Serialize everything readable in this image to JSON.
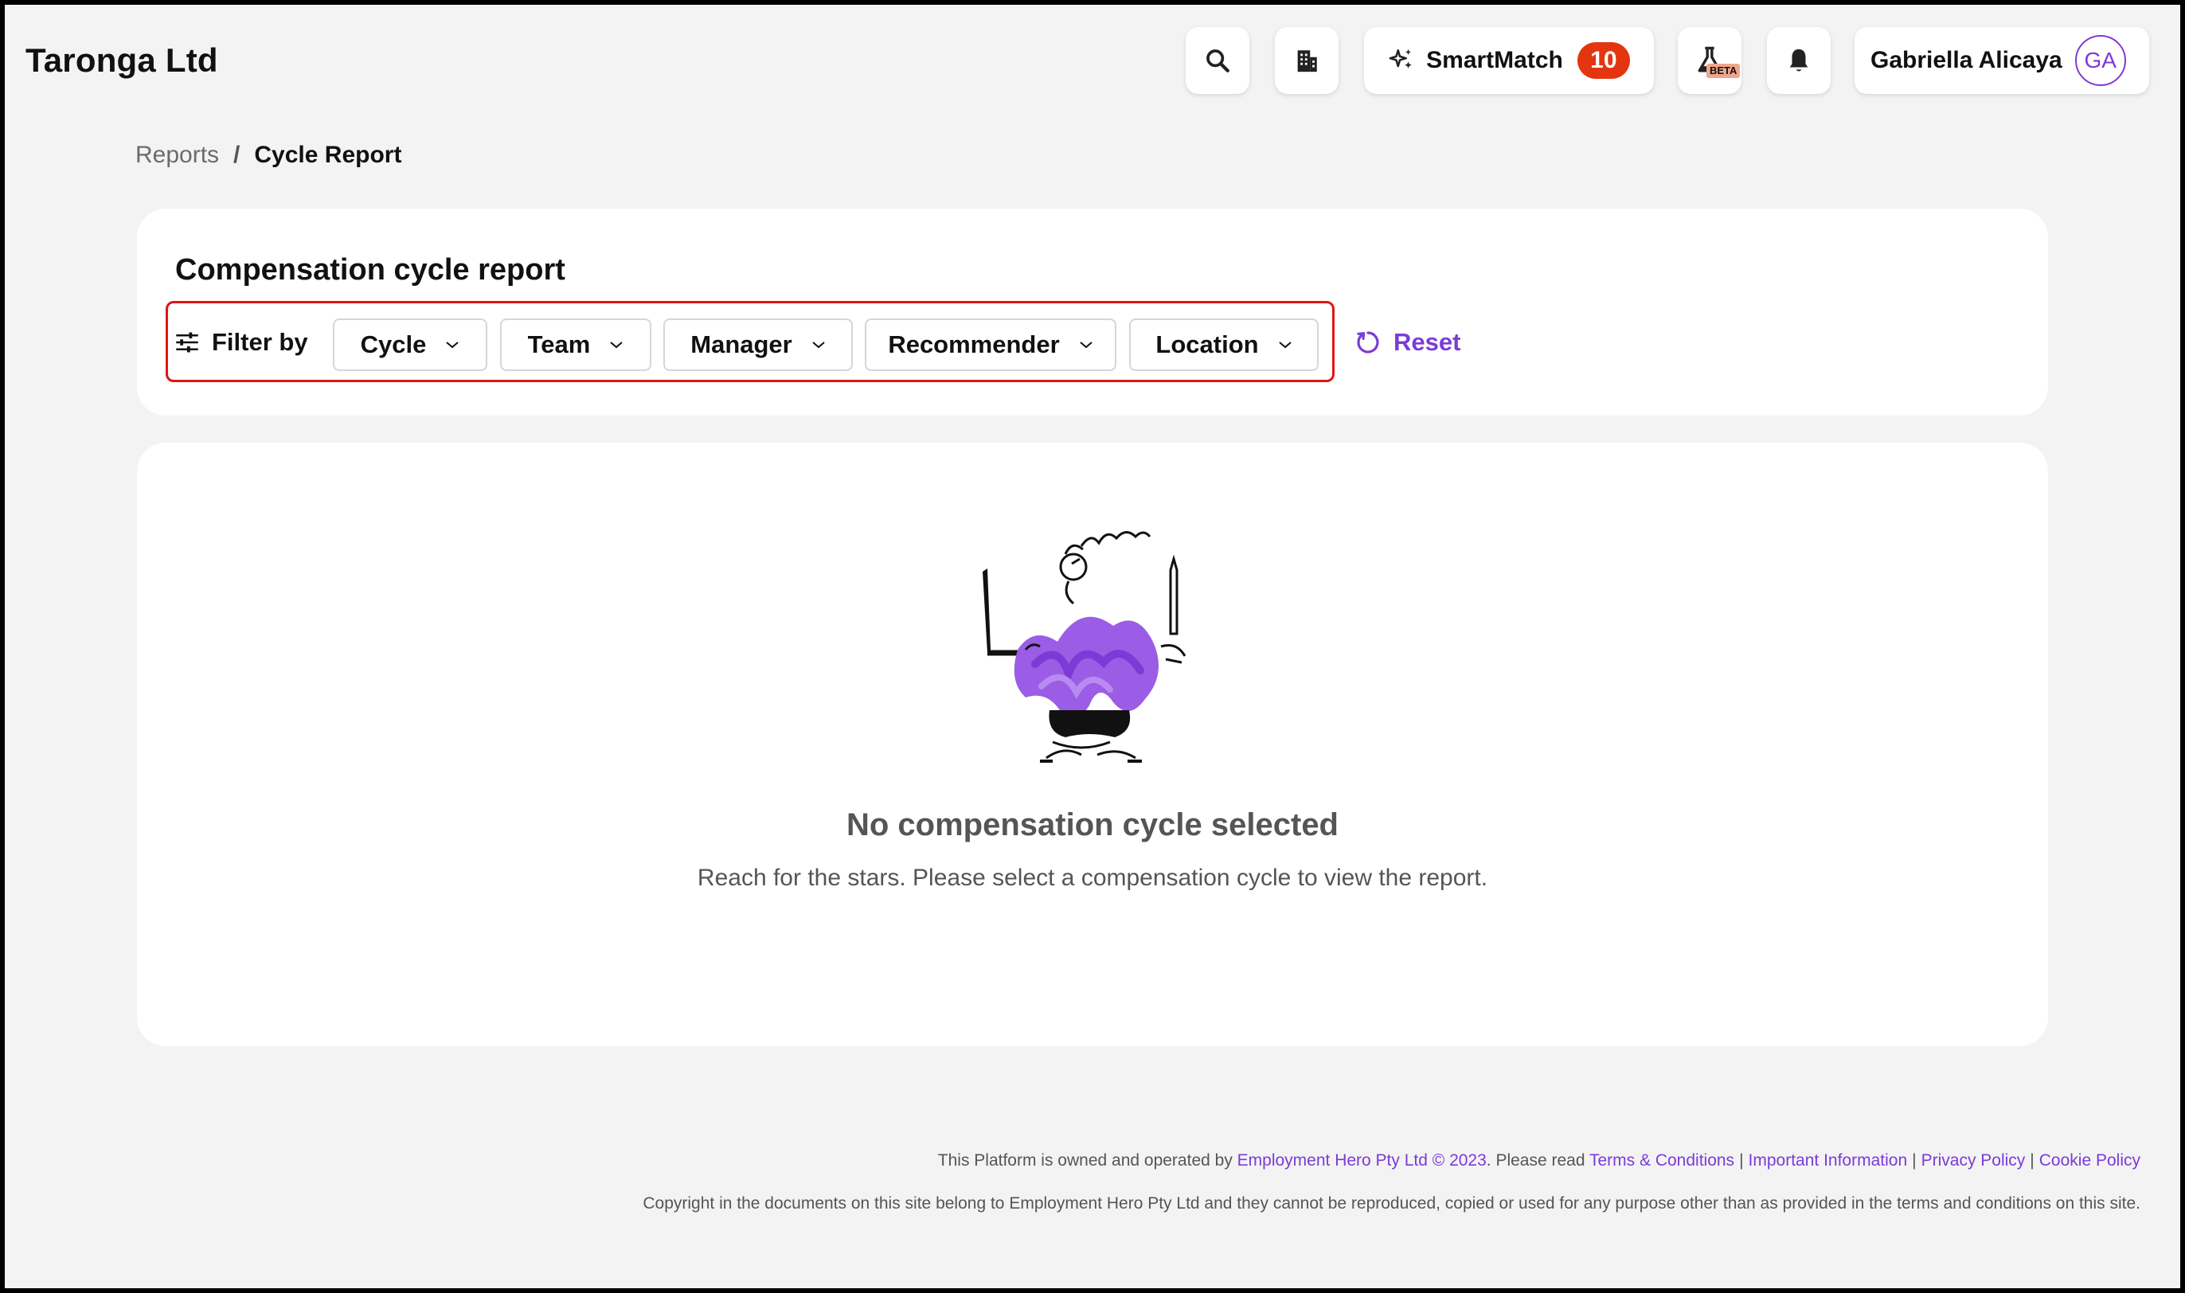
{
  "header": {
    "brand": "Taronga Ltd",
    "smartmatch_label": "SmartMatch",
    "smartmatch_count": "10",
    "beta_badge": "BETA",
    "user_name": "Gabriella Alicaya",
    "user_initials": "GA",
    "icons": [
      "search-icon",
      "building-icon",
      "sparkle-icon",
      "flask-icon",
      "bell-icon"
    ]
  },
  "breadcrumb": {
    "parent": "Reports",
    "separator": "/",
    "current": "Cycle Report"
  },
  "filters": {
    "title": "Compensation cycle report",
    "filter_by_label": "Filter by",
    "dropdowns": [
      "Cycle",
      "Team",
      "Manager",
      "Recommender",
      "Location"
    ],
    "reset_label": "Reset"
  },
  "empty_state": {
    "title": "No compensation cycle selected",
    "message": "Reach for the stars. Please select a compensation cycle to view the report."
  },
  "footer": {
    "line1_prefix": "This Platform is owned and operated by ",
    "owner_link": "Employment Hero Pty Ltd © 2023",
    "line1_mid": ". Please read ",
    "links": [
      "Terms & Conditions",
      "Important Information",
      "Privacy Policy",
      "Cookie Policy"
    ],
    "line2": "Copyright in the documents on this site belong to Employment Hero Pty Ltd and they cannot be reproduced, copied or used for any purpose other than as provided in the terms and conditions on this site."
  },
  "colors": {
    "accent": "#7c3bd6",
    "badge": "#e3350f",
    "highlight": "#e01515",
    "background": "#f3f3f4"
  }
}
